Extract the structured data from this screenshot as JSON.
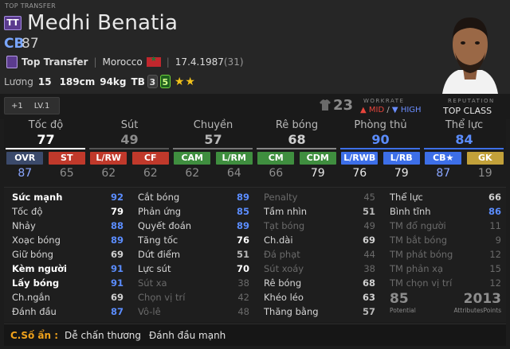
{
  "player": {
    "season_label": "TOP TRANSFER",
    "season_badge": "TT",
    "name": "Medhi Benatia",
    "position": "CB",
    "ovr": "87",
    "team": "Top Transfer",
    "nation": "Morocco",
    "birthdate": "17.4.1987",
    "age": "(31)",
    "salary_label": "Lương",
    "salary": "15",
    "height": "189cm",
    "weight": "94kg",
    "body_type": "TB",
    "left_foot": "3",
    "right_foot": "5",
    "skill_stars": "★★",
    "skill_stars_count": 2
  },
  "strip": {
    "level_plus": "+1",
    "level": "LV.1",
    "shirt_number": "23",
    "workrate_title": "WORKRATE",
    "workrate_att": "MID",
    "workrate_sep": "/",
    "workrate_def": "HIGH",
    "reputation_title": "REPUTATION",
    "reputation_value": "TOP CLASS"
  },
  "main_stats": [
    {
      "label": "Tốc độ",
      "value": "77",
      "color": "#ffffff",
      "bar": "#ffffff"
    },
    {
      "label": "Sút",
      "value": "49",
      "color": "#8d8d8d",
      "bar": "#555555"
    },
    {
      "label": "Chuyền",
      "value": "57",
      "color": "#b8b8b8",
      "bar": "#777777"
    },
    {
      "label": "Rê bóng",
      "value": "68",
      "color": "#d0d0d0",
      "bar": "#888888"
    },
    {
      "label": "Phòng thủ",
      "value": "90",
      "color": "#5b8dff",
      "bar": "#3d6fe8"
    },
    {
      "label": "Thể lực",
      "value": "84",
      "color": "#5b8dff",
      "bar": "#3d6fe8"
    }
  ],
  "positions": [
    {
      "name": "OVR",
      "value": "87",
      "bg": "#3b4a6b",
      "vcolor": "#8aa6ff"
    },
    {
      "name": "ST",
      "value": "65",
      "bg": "#c0392b",
      "vcolor": "#8d8d8d"
    },
    {
      "name": "L/RW",
      "value": "62",
      "bg": "#c0392b",
      "vcolor": "#8d8d8d"
    },
    {
      "name": "CF",
      "value": "62",
      "bg": "#c0392b",
      "vcolor": "#8d8d8d"
    },
    {
      "name": "CAM",
      "value": "62",
      "bg": "#3f8e3f",
      "vcolor": "#8d8d8d"
    },
    {
      "name": "L/RM",
      "value": "64",
      "bg": "#3f8e3f",
      "vcolor": "#8d8d8d"
    },
    {
      "name": "CM",
      "value": "66",
      "bg": "#3f8e3f",
      "vcolor": "#8d8d8d"
    },
    {
      "name": "CDM",
      "value": "79",
      "bg": "#3f8e3f",
      "vcolor": "#e8e8e8"
    },
    {
      "name": "L/RWB",
      "value": "76",
      "bg": "#3d6fe8",
      "vcolor": "#e8e8e8"
    },
    {
      "name": "L/RB",
      "value": "79",
      "bg": "#3d6fe8",
      "vcolor": "#e8e8e8"
    },
    {
      "name": "CB★",
      "value": "87",
      "bg": "#3d6fe8",
      "vcolor": "#8aa6ff"
    },
    {
      "name": "GK",
      "value": "19",
      "bg": "#c2a13a",
      "vcolor": "#8d8d8d"
    }
  ],
  "detail": {
    "col1": [
      {
        "label": "Sức mạnh",
        "value": "92",
        "bold": true,
        "color": "#5b8dff"
      },
      {
        "label": "Tốc độ",
        "value": "79",
        "bold": false,
        "color": "#ffffff"
      },
      {
        "label": "Nhảy",
        "value": "88",
        "bold": false,
        "color": "#5b8dff"
      },
      {
        "label": "Xoạc bóng",
        "value": "89",
        "bold": false,
        "color": "#5b8dff"
      },
      {
        "label": "Giữ bóng",
        "value": "69",
        "bold": false,
        "color": "#d0d0d0"
      },
      {
        "label": "Kèm người",
        "value": "91",
        "bold": true,
        "color": "#5b8dff"
      },
      {
        "label": "Lấy bóng",
        "value": "91",
        "bold": true,
        "color": "#5b8dff"
      },
      {
        "label": "Ch.ngắn",
        "value": "69",
        "bold": false,
        "color": "#d0d0d0"
      },
      {
        "label": "Đánh đầu",
        "value": "87",
        "bold": false,
        "color": "#5b8dff"
      }
    ],
    "col2": [
      {
        "label": "Cắt bóng",
        "value": "89",
        "dim": false,
        "color": "#5b8dff"
      },
      {
        "label": "Phản ứng",
        "value": "85",
        "dim": false,
        "color": "#5b8dff"
      },
      {
        "label": "Quyết đoán",
        "value": "89",
        "dim": false,
        "color": "#5b8dff"
      },
      {
        "label": "Tăng tốc",
        "value": "76",
        "dim": false,
        "color": "#ffffff"
      },
      {
        "label": "Dứt điểm",
        "value": "51",
        "dim": false,
        "color": "#b8b8b8"
      },
      {
        "label": "Lực sút",
        "value": "70",
        "dim": false,
        "color": "#ffffff"
      },
      {
        "label": "Sút xa",
        "value": "38",
        "dim": true,
        "color": "#6a6a6a"
      },
      {
        "label": "Chọn vị trí",
        "value": "42",
        "dim": true,
        "color": "#6a6a6a"
      },
      {
        "label": "Vô-lê",
        "value": "48",
        "dim": true,
        "color": "#6a6a6a"
      }
    ],
    "col3": [
      {
        "label": "Penalty",
        "value": "45",
        "dim": true,
        "color": "#6a6a6a"
      },
      {
        "label": "Tầm nhìn",
        "value": "51",
        "dim": false,
        "color": "#b8b8b8"
      },
      {
        "label": "Tạt bóng",
        "value": "49",
        "dim": true,
        "color": "#6a6a6a"
      },
      {
        "label": "Ch.dài",
        "value": "69",
        "dim": false,
        "color": "#d0d0d0"
      },
      {
        "label": "Đá phạt",
        "value": "44",
        "dim": true,
        "color": "#6a6a6a"
      },
      {
        "label": "Sút xoáy",
        "value": "38",
        "dim": true,
        "color": "#6a6a6a"
      },
      {
        "label": "Rê bóng",
        "value": "68",
        "dim": false,
        "color": "#d0d0d0"
      },
      {
        "label": "Khéo léo",
        "value": "63",
        "dim": false,
        "color": "#d0d0d0"
      },
      {
        "label": "Thăng bằng",
        "value": "57",
        "dim": false,
        "color": "#b8b8b8"
      }
    ],
    "col4": [
      {
        "label": "Thể lực",
        "value": "66",
        "dim": false,
        "color": "#d0d0d0"
      },
      {
        "label": "Bình tĩnh",
        "value": "86",
        "dim": false,
        "color": "#5b8dff"
      },
      {
        "label": "TM đổ người",
        "value": "11",
        "dim": true,
        "color": "#6a6a6a"
      },
      {
        "label": "TM bắt bóng",
        "value": "9",
        "dim": true,
        "color": "#6a6a6a"
      },
      {
        "label": "TM phát bóng",
        "value": "12",
        "dim": true,
        "color": "#6a6a6a"
      },
      {
        "label": "TM phản xạ",
        "value": "15",
        "dim": true,
        "color": "#6a6a6a"
      },
      {
        "label": "TM chọn vị trí",
        "value": "12",
        "dim": true,
        "color": "#6a6a6a"
      }
    ],
    "potential_value": "85",
    "potential_label": "Potential",
    "attr_points_value": "2013",
    "attr_points_label": "AttributesPoints"
  },
  "traits": {
    "title": "C.Số ẩn :",
    "items": [
      "Dễ chấn thương",
      "Đánh đầu mạnh"
    ]
  },
  "colors": {
    "accent_blue": "#5b8dff",
    "workrate_mid": "#e8453c",
    "workrate_high": "#6a8dff",
    "trait_title": "#f0a21b"
  }
}
